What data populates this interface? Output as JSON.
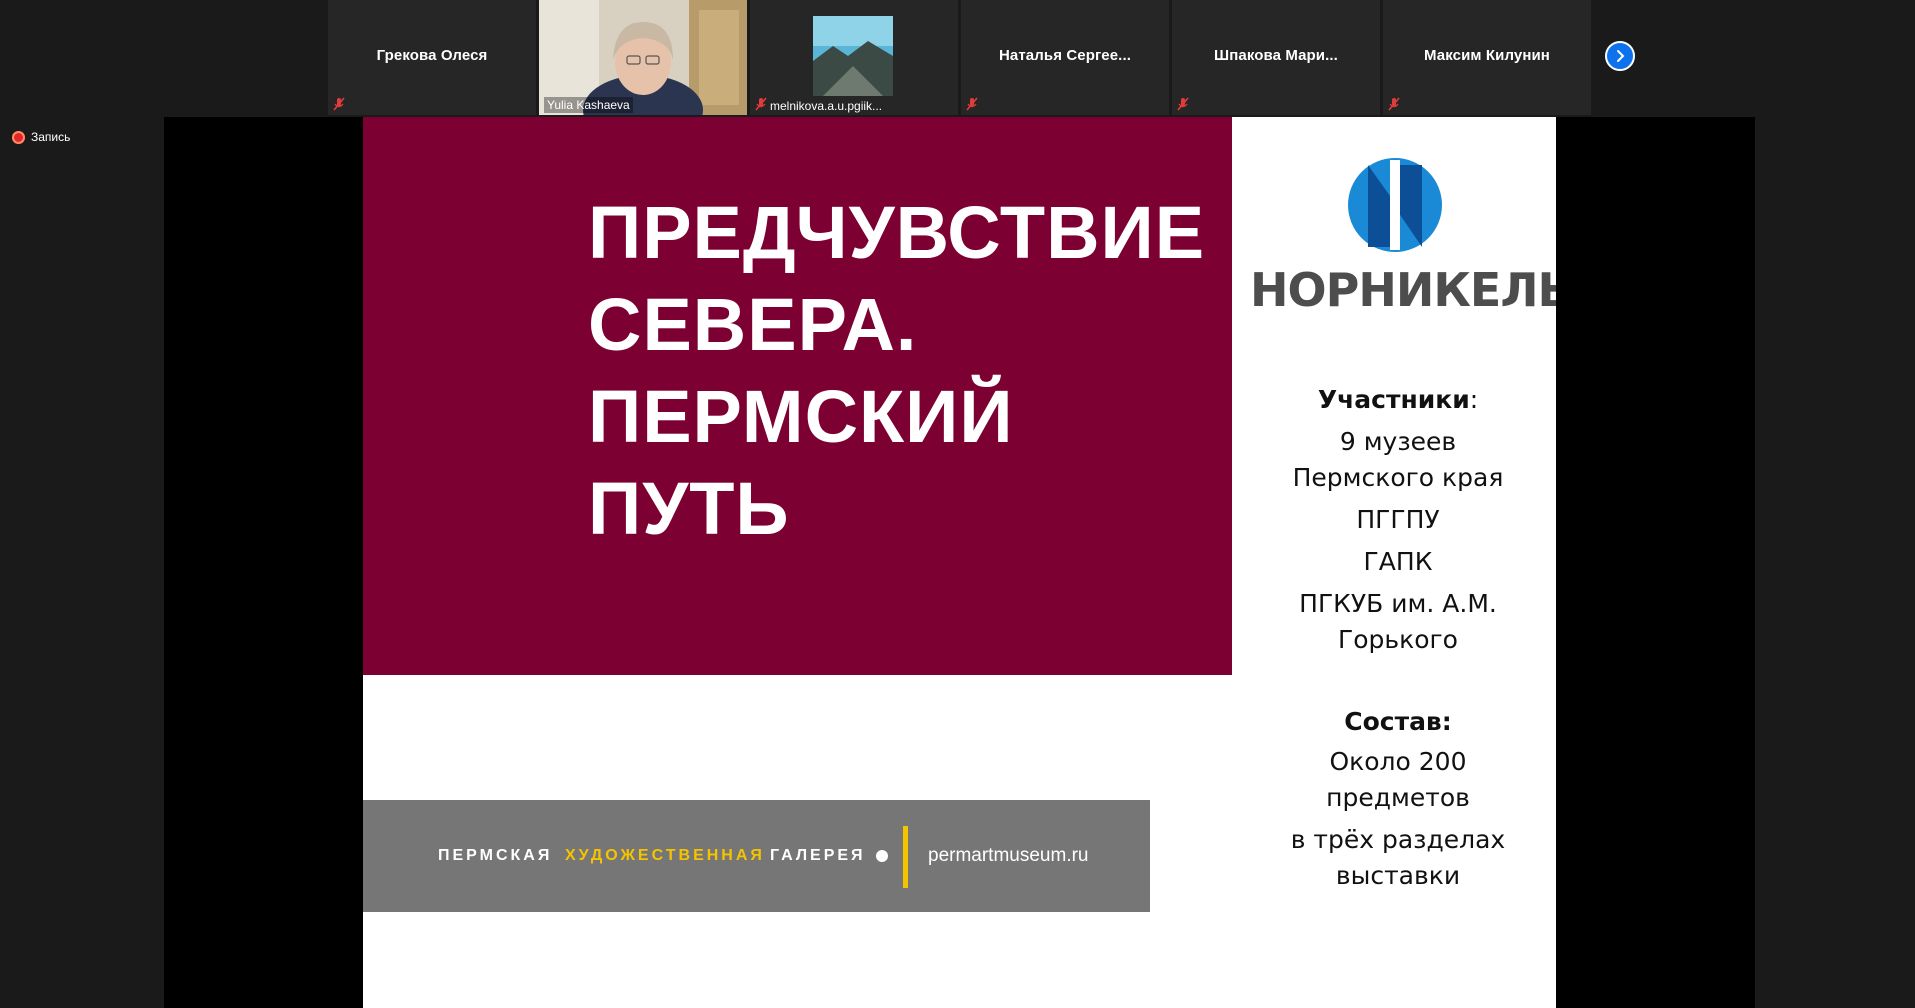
{
  "meeting": {
    "recording_label": "Запись"
  },
  "participants": [
    {
      "name": "Грекова Олеся",
      "muted": true
    },
    {
      "name": "Yulia Kashaeva",
      "muted": false,
      "video": true
    },
    {
      "name": "melnikova.a.u.pgiik...",
      "muted": true
    },
    {
      "name": "Наталья  Сергее...",
      "muted": true
    },
    {
      "name": "Шпакова  Мари...",
      "muted": true
    },
    {
      "name": "Максим Килунин",
      "muted": true
    }
  ],
  "slide": {
    "title_lines": [
      "ПРЕДЧУВСТВИЕ",
      "СЕВЕРА.",
      "ПЕРМСКИЙ",
      "ПУТЬ"
    ],
    "logo_text": "НОРНИКЕЛЬ",
    "participants_heading": "Участники",
    "participants_colon": ":",
    "participants_lines": [
      "9 музеев",
      "Пермского края",
      "ПГГПУ",
      "ГАПК",
      "ПГКУБ им. А.М.",
      "Горького"
    ],
    "composition_heading": "Состав:",
    "composition_lines": [
      "Около 200",
      "предметов",
      "в трёх разделах",
      "выставки"
    ],
    "gallery_part1": "ПЕРМСКАЯ",
    "gallery_part2": "ХУДОЖЕСТВЕННАЯ",
    "gallery_part3": "ГАЛЕРЕЯ",
    "gallery_site": "permartmuseum.ru"
  },
  "colors": {
    "slide_red": "#7d0033",
    "logo_blue": "#1a8ad6",
    "logo_dark_blue": "#0c4f97",
    "gallery_yellow": "#f5c400",
    "zoom_blue": "#0e72ed"
  }
}
